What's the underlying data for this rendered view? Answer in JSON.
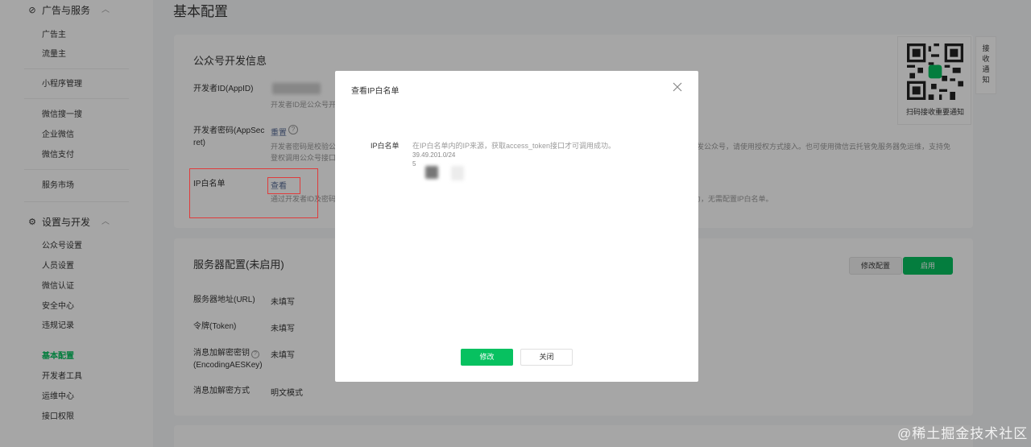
{
  "page_title": "基本配置",
  "sidebar": {
    "groups": [
      {
        "label": "广告与服务",
        "icon": "compass-icon",
        "items": [
          "广告主",
          "流量主"
        ]
      },
      {
        "label": "设置与开发",
        "icon": "gear-icon",
        "items": [
          "公众号设置",
          "人员设置",
          "微信认证",
          "安全中心",
          "违规记录",
          "基本配置",
          "开发者工具",
          "运维中心",
          "接口权限"
        ]
      }
    ],
    "misc_items": [
      "小程序管理",
      "微信搜一搜",
      "企业微信",
      "微信支付",
      "服务市场"
    ],
    "active_item": "基本配置"
  },
  "dev_info": {
    "title": "公众号开发信息",
    "appid_label": "开发者ID(AppID)",
    "appid_desc": "开发者ID是公众号开",
    "secret_label_1": "开发者密码(AppSec",
    "secret_label_2": "ret)",
    "secret_action": "重置",
    "secret_desc_1": "开发者密码是校验公",
    "secret_desc_2": "登权调用公众号接口",
    "secret_desc_right_1": "开发公众号，请使用授权方式接入。也可使用微信云托管免服务器免运维，支持免",
    "ip_label": "IP白名单",
    "ip_action": "查看",
    "ip_desc_left": "通过开发者ID及密码",
    "ip_desc_right": "能力，无需配置IP白名单。"
  },
  "server_config": {
    "title": "服务器配置(未启用)",
    "modify_button": "修改配置",
    "enable_button": "启用",
    "rows": [
      {
        "label": "服务器地址(URL)",
        "value": "未填写"
      },
      {
        "label": "令牌(Token)",
        "value": "未填写"
      },
      {
        "label": "消息加解密密钥",
        "label2": "(EncodingAESKey)",
        "value": "未填写"
      },
      {
        "label": "消息加解密方式",
        "value": "明文模式"
      }
    ]
  },
  "qr_panel": {
    "text": "扫码接收重要通知"
  },
  "notice_tab": {
    "chars": [
      "接",
      "收",
      "通",
      "知"
    ]
  },
  "modal": {
    "title": "查看IP白名单",
    "ip_label": "IP白名单",
    "ip_desc": "在IP白名单内的IP来源，获取access_token接口才可调用成功。",
    "ip_value_1": "39.49.201.0/24",
    "ip_value_2": "5",
    "save_button": "修改",
    "close_button": "关闭"
  },
  "watermark": "@稀土掘金技术社区",
  "colors": {
    "brand_green": "#07c160",
    "highlight_red": "#e03b3b",
    "link_blue": "#576b95"
  }
}
